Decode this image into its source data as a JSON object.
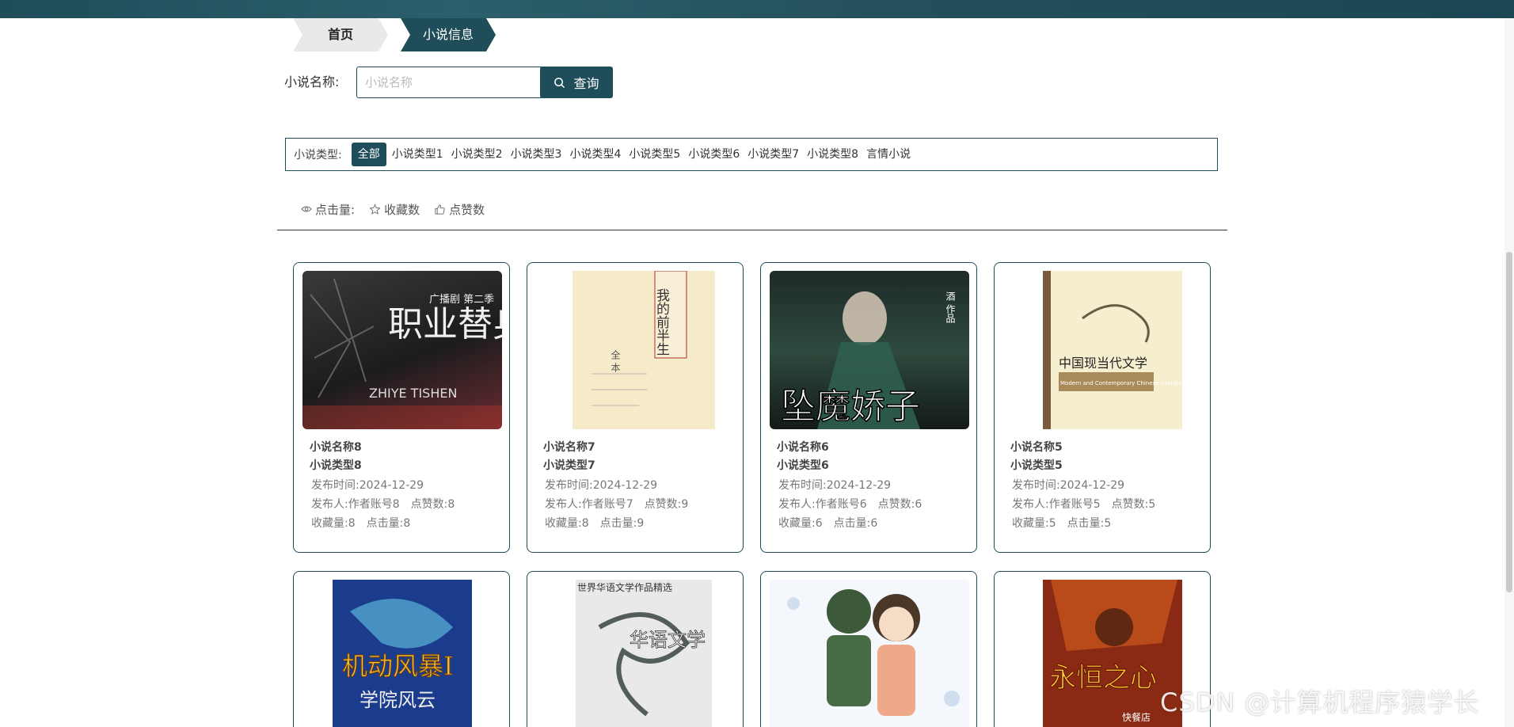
{
  "breadcrumb": {
    "home": "首页",
    "current": "小说信息"
  },
  "search": {
    "label": "小说名称:",
    "placeholder": "小说名称",
    "value": "",
    "button": "查询"
  },
  "types": {
    "label": "小说类型:",
    "items": [
      "全部",
      "小说类型1",
      "小说类型2",
      "小说类型3",
      "小说类型4",
      "小说类型5",
      "小说类型6",
      "小说类型7",
      "小说类型8",
      "言情小说"
    ],
    "active": "全部"
  },
  "sort": {
    "clicks": "点击量:",
    "favorites": "收藏数",
    "likes": "点赞数"
  },
  "labels": {
    "publish_time": "发布时间:",
    "publisher": "发布人:",
    "likes": "点赞数:",
    "favorites": "收藏量:",
    "clicks": "点击量:"
  },
  "novels": [
    {
      "name": "小说名称8",
      "type": "小说类型8",
      "date": "2024-12-29",
      "publisher": "作者账号8",
      "likes": "8",
      "favorites": "8",
      "clicks": "8"
    },
    {
      "name": "小说名称7",
      "type": "小说类型7",
      "date": "2024-12-29",
      "publisher": "作者账号7",
      "likes": "9",
      "favorites": "8",
      "clicks": "9"
    },
    {
      "name": "小说名称6",
      "type": "小说类型6",
      "date": "2024-12-29",
      "publisher": "作者账号6",
      "likes": "6",
      "favorites": "6",
      "clicks": "6"
    },
    {
      "name": "小说名称5",
      "type": "小说类型5",
      "date": "2024-12-29",
      "publisher": "作者账号5",
      "likes": "5",
      "favorites": "5",
      "clicks": "5"
    }
  ],
  "covers": [
    {
      "text": "职业替身",
      "sub": "ZHIYE TISHEN",
      "tag": "广播剧 第二季"
    },
    {
      "text": "我的前半生",
      "sub": "全 本"
    },
    {
      "text": "坠魔娇子",
      "tag": "酒 作品"
    },
    {
      "text": "中国现当代文学",
      "sub": "Modern and Contemporary Chinese Literature"
    },
    {
      "text": "机动风暴I",
      "sub": "学院风云"
    },
    {
      "text": "华语文学",
      "tag": "世界华语文学作品精选"
    },
    {
      "text": ""
    },
    {
      "text": "永恒之心",
      "tag": "快餐店"
    }
  ],
  "watermark": "CSDN @计算机程序猿学长",
  "colors": {
    "primary": "#1f4d5a",
    "border": "#1f4d5a"
  }
}
